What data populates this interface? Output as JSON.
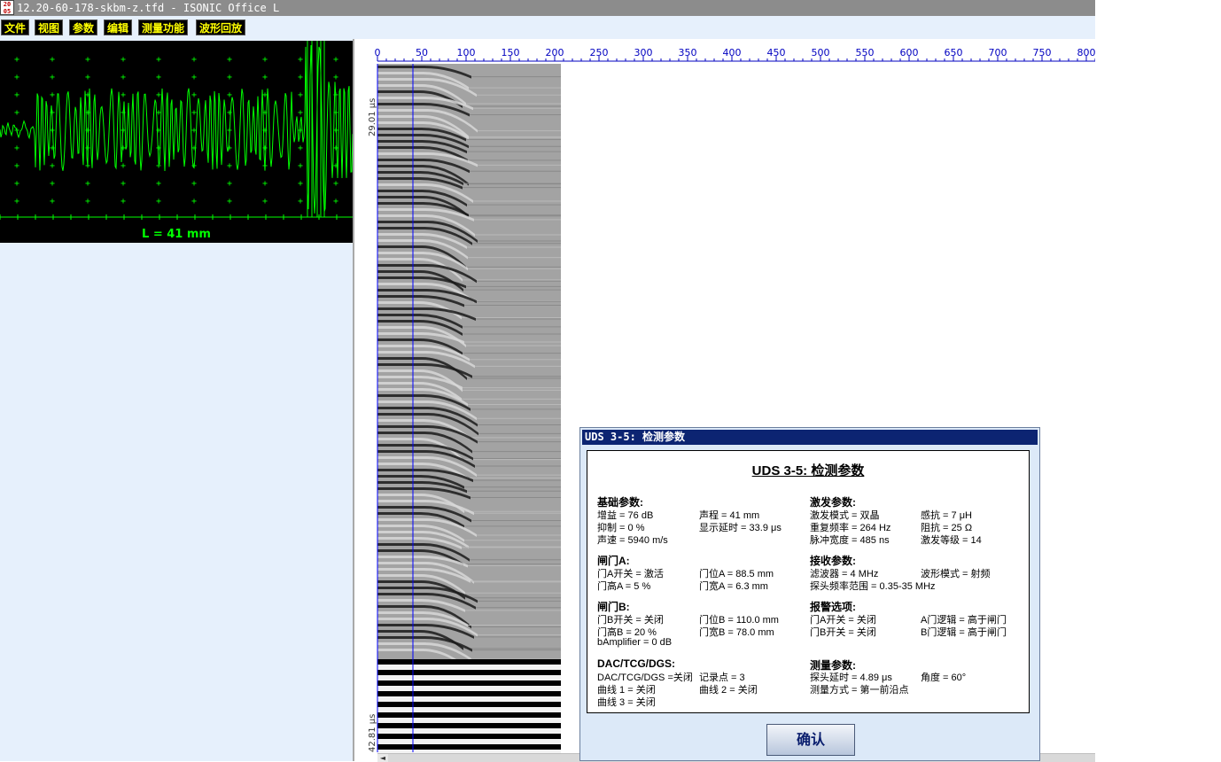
{
  "window": {
    "title": "12.20-60-178-skbm-z.tfd - ISONIC Office L",
    "icon_text": "20\n05",
    "icon_name": "isonic-app-icon"
  },
  "menu": [
    {
      "label": "文件"
    },
    {
      "label": "视图"
    },
    {
      "label": "参数"
    },
    {
      "label": "编辑"
    },
    {
      "label": "测量功能"
    },
    {
      "label": "波形回放"
    }
  ],
  "ascan": {
    "label": "L = 41 mm",
    "trace_color": "#00ff00",
    "grid_color": "#00ff00"
  },
  "bscan": {
    "ruler_ticks": [
      "0",
      "50",
      "100",
      "150",
      "200",
      "250",
      "300",
      "350",
      "400",
      "450",
      "500",
      "550",
      "600",
      "650",
      "700",
      "750",
      "800"
    ],
    "y_top_label": "29.01 μs",
    "y_bottom_label": "42.81 μs",
    "cursor_color": "#0000ff",
    "scroll_left_arrow": "◄"
  },
  "dialog": {
    "title": "UDS 3-5: 检测参数",
    "heading": "UDS 3-5: 检测参数",
    "ok_label": "确认",
    "sections": {
      "basic": {
        "title": "基础参数:",
        "gain": "增益 = 76 dB",
        "reject": "抑制 = 0 %",
        "velocity": "声速 = 5940 m/s",
        "range": "声程 = 41 mm",
        "display_delay": "显示延时 = 33.9 μs"
      },
      "pulser": {
        "title": "激发参数:",
        "mode": "激发模式 = 双晶",
        "prf": "重复频率 = 264 Hz",
        "pulse_width": "脉冲宽度 = 485 ns",
        "inductance": "感抗 = 7 μH",
        "damping": "阻抗 = 25 Ω",
        "level": "激发等级 = 14"
      },
      "gate_a": {
        "title": "闸门A:",
        "on": "门A开关 = 激活",
        "height": "门高A = 5 %",
        "pos": "门位A = 88.5 mm",
        "width": "门宽A = 6.3 mm"
      },
      "receiver": {
        "title": "接收参数:",
        "filter": "滤波器 = 4 MHz",
        "rectify": "波形模式 = 射频",
        "probe_range": "探头频率范围 = 0.35-35 MHz"
      },
      "gate_b": {
        "title": "闸门B:",
        "on": "门B开关 = 关闭",
        "height": "门高B = 20 %",
        "amp": "bAmplifier = 0 dB",
        "pos": "门位B = 110.0 mm",
        "width": "门宽B = 78.0 mm"
      },
      "alarm": {
        "title": "报警选项:",
        "a_on": "门A开关 = 关闭",
        "b_on": "门B开关 = 关闭",
        "a_logic": "A门逻辑 = 高于闸门",
        "b_logic": "B门逻辑 = 高于闸门"
      },
      "dac": {
        "title": "DAC/TCG/DGS:",
        "mode": "DAC/TCG/DGS =关闭",
        "points": "记录点 = 3",
        "curve1": "曲线 1 = 关闭",
        "curve2": "曲线 2 = 关闭",
        "curve3": "曲线 3 = 关闭"
      },
      "measure": {
        "title": "测量参数:",
        "probe_delay": "探头延时 = 4.89 μs",
        "angle": "角度 = 60°",
        "mode": "测量方式 = 第一前沿点"
      }
    }
  }
}
